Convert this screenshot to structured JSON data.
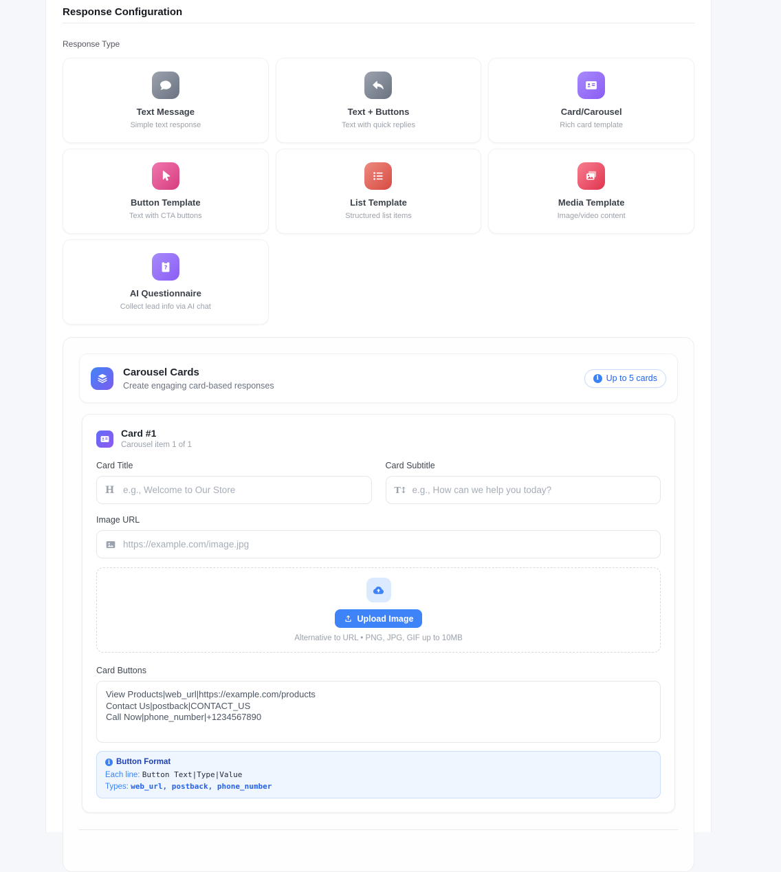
{
  "colors": {
    "accent_blue": "#3f83f8",
    "badge_blue": "#2563eb",
    "info_box_bg": "#eff6ff",
    "gradient_gray": [
      "#9ca3af",
      "#6b7280"
    ],
    "gradient_violet": [
      "#a78bfa",
      "#8b5cf6"
    ],
    "gradient_pink": [
      "#f177ae",
      "#d63d7f"
    ],
    "gradient_red": [
      "#ec8b80",
      "#d84a42"
    ],
    "gradient_rose": [
      "#f77f90",
      "#e1344f"
    ],
    "gradient_blue_violet": [
      "#4285f5",
      "#7a5cf0"
    ]
  },
  "header": {
    "title": "Response Configuration"
  },
  "response_type": {
    "label": "Response Type",
    "options": [
      {
        "label": "Text Message",
        "description": "Simple text response"
      },
      {
        "label": "Text + Buttons",
        "description": "Text with quick replies"
      },
      {
        "label": "Card/Carousel",
        "description": "Rich card template"
      },
      {
        "label": "Button Template",
        "description": "Text with CTA buttons"
      },
      {
        "label": "List Template",
        "description": "Structured list items"
      },
      {
        "label": "Media Template",
        "description": "Image/video content"
      },
      {
        "label": "AI Questionnaire",
        "description": "Collect lead info via AI chat"
      }
    ]
  },
  "carousel": {
    "title": "Carousel Cards",
    "subtitle": "Create engaging card-based responses",
    "badge_label": "Up to 5 cards"
  },
  "card_editor": {
    "title": "Card #1",
    "subtitle": "Carousel item 1 of 1",
    "card_title": {
      "label": "Card Title",
      "placeholder": "e.g., Welcome to Our Store"
    },
    "card_subtitle": {
      "label": "Card Subtitle",
      "placeholder": "e.g., How can we help you today?"
    },
    "image_url": {
      "label": "Image URL",
      "placeholder": "https://example.com/image.jpg"
    },
    "upload": {
      "button_label": "Upload Image",
      "hint": "Alternative to URL • PNG, JPG, GIF up to 10MB"
    },
    "card_buttons": {
      "label": "Card Buttons",
      "value": "View Products|web_url|https://example.com/products\nContact Us|postback|CONTACT_US\nCall Now|phone_number|+1234567890"
    },
    "format_info": {
      "title": "Button Format",
      "line_label": "Each line:",
      "line_code": "Button Text|Type|Value",
      "types_label": "Types:",
      "types_value": "web_url, postback, phone_number"
    }
  }
}
